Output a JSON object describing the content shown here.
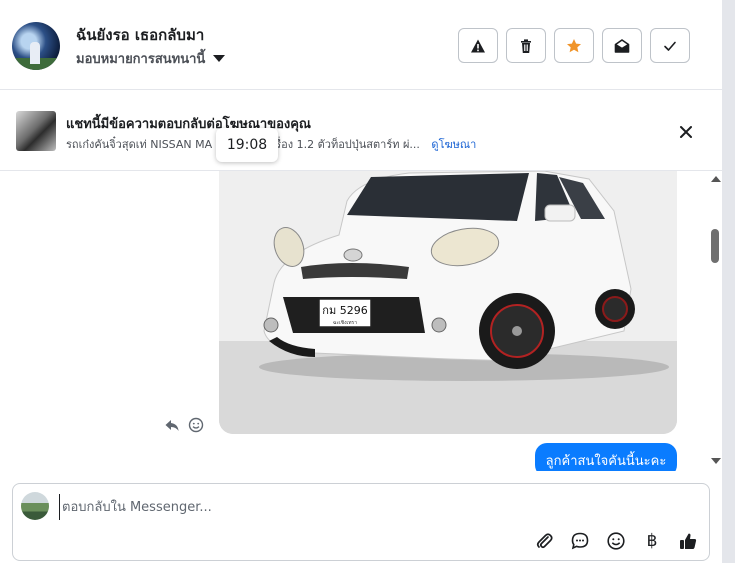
{
  "header": {
    "contact_name": "ฉันยังรอ เธอกลับมา",
    "assign_label": "มอบหมายการสนทนานี้",
    "actions": [
      {
        "name": "report-button",
        "icon": "warning-icon"
      },
      {
        "name": "delete-button",
        "icon": "trash-icon"
      },
      {
        "name": "star-button",
        "icon": "star-icon",
        "color": "#f0942a"
      },
      {
        "name": "mark-unread-button",
        "icon": "envelope-open-icon"
      },
      {
        "name": "mark-done-button",
        "icon": "check-icon"
      }
    ]
  },
  "ad_banner": {
    "title": "แชทนี้มีข้อความตอบกลับต่อโฆษณาของคุณ",
    "description": "รถเก๋งคันจิ๋วสุดเท่ NISSAN MA",
    "description_rest": "เครื่อง 1.2 ตัวท็อปปุ่นสตาร์ท ผ่...",
    "link_label": "ดูโฆษณา",
    "close_icon": "close-icon"
  },
  "tooltip": {
    "time": "19:08"
  },
  "messages": [
    {
      "type": "image",
      "subject": "white Nissan March car",
      "plate_text": "กม 5296",
      "plate_sub": "ฉะเชิงเทรา"
    },
    {
      "type": "text",
      "sender": "me",
      "text": "ลูกค้าสนใจคันนี้นะคะ",
      "color": "#0a7cff"
    }
  ],
  "composer": {
    "placeholder": "ตอบกลับใน Messenger...",
    "value": "",
    "currency_symbol": "฿"
  },
  "colors": {
    "accent": "#0a7cff",
    "link": "#1a63d4",
    "star": "#f0942a"
  }
}
